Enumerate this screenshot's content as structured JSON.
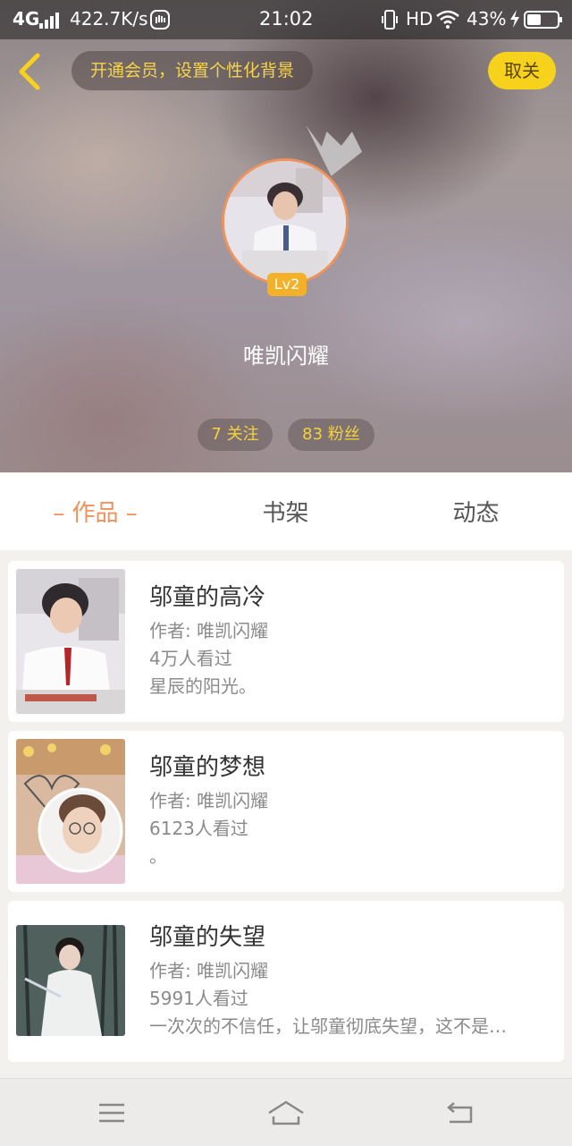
{
  "status_bar": {
    "network": "4G",
    "speed": "422.7K/s",
    "time": "21:02",
    "hd": "HD",
    "battery": "43%"
  },
  "header": {
    "vip_prompt": "开通会员，设置个性化背景",
    "unfollow_label": "取关"
  },
  "profile": {
    "level": "Lv2",
    "username": "唯凯闪耀",
    "following": "7 关注",
    "followers": "83 粉丝"
  },
  "tabs": [
    {
      "label": "– 作品 –",
      "active": true
    },
    {
      "label": "书架",
      "active": false
    },
    {
      "label": "动态",
      "active": false
    }
  ],
  "works": [
    {
      "title": "邬童的高冷",
      "author": "作者: 唯凯闪耀",
      "views": "4万人看过",
      "summary": "星辰的阳光。"
    },
    {
      "title": "邬童的梦想",
      "author": "作者: 唯凯闪耀",
      "views": "6123人看过",
      "summary": "。"
    },
    {
      "title": "邬童的失望",
      "author": "作者: 唯凯闪耀",
      "views": "5991人看过",
      "summary": "一次次的不信任，让邬童彻底失望，这不是…"
    }
  ],
  "colors": {
    "accent": "#f0925b",
    "yellow": "#f6d21c",
    "level_badge": "#f3b12a"
  }
}
